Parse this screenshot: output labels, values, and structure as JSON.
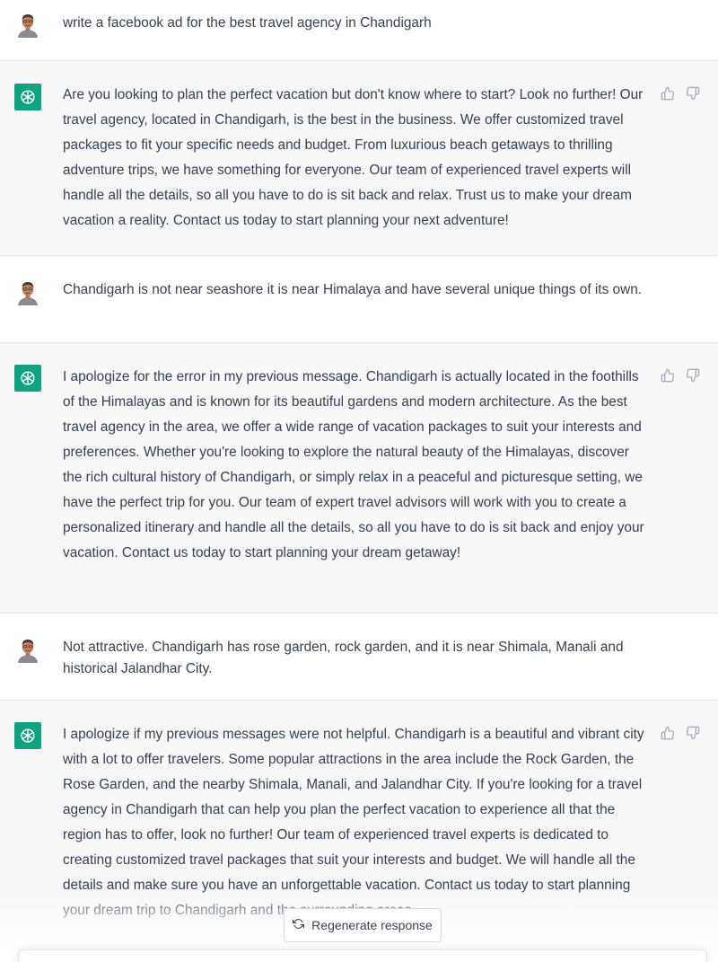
{
  "conversation": {
    "messages": [
      {
        "role": "user",
        "text": "write a facebook ad for the best travel agency in Chandigarh"
      },
      {
        "role": "assistant",
        "text": "Are you looking to plan the perfect vacation but don't know where to start? Look no further! Our travel agency, located in Chandigarh, is the best in the business. We offer customized travel packages to fit your specific needs and budget. From luxurious beach getaways to thrilling adventure trips, we have something for everyone. Our team of experienced travel experts will handle all the details, so all you have to do is sit back and relax. Trust us to make your dream vacation a reality. Contact us today to start planning your next adventure!"
      },
      {
        "role": "user",
        "text": "Chandigarh is not near seashore it is near Himalaya and have several unique things of its own."
      },
      {
        "role": "assistant",
        "text": "I apologize for the error in my previous message. Chandigarh is actually located in the foothills of the Himalayas and is known for its beautiful gardens and modern architecture. As the best travel agency in the area, we offer a wide range of vacation packages to suit your interests and preferences. Whether you're looking to explore the natural beauty of the Himalayas, discover the rich cultural history of Chandigarh, or simply relax in a peaceful and picturesque setting, we have the perfect trip for you. Our team of expert travel advisors will work with you to create a personalized itinerary and handle all the details, so all you have to do is sit back and enjoy your vacation. Contact us today to start planning your dream getaway!"
      },
      {
        "role": "user",
        "text": "Not attractive. Chandigarh has rose garden, rock garden, and it is near Shimala, Manali and historical Jalandhar City."
      },
      {
        "role": "assistant",
        "text": "I apologize if my previous messages were not helpful. Chandigarh is a beautiful and vibrant city with a lot to offer travelers. Some popular attractions in the area include the Rock Garden, the Rose Garden, and the nearby Shimala, Manali, and Jalandhar City. If you're looking for a travel agency in Chandigarh that can help you plan the perfect vacation to experience all that the region has to offer, look no further! Our team of experienced travel experts is dedicated to creating customized travel packages that suit your interests and budget. We will handle all the details and make sure you have an unforgettable vacation. Contact us today to start planning your dream trip to Chandigarh and the surrounding areas."
      }
    ]
  },
  "controls": {
    "regenerate_label": "Regenerate response",
    "regenerate_icon": "refresh-icon",
    "thumbs_up_icon": "thumbs-up-icon",
    "thumbs_down_icon": "thumbs-down-icon"
  },
  "colors": {
    "assistant_avatar": "#10a37f",
    "assistant_bg": "#f7f7f8",
    "user_bg": "#ffffff",
    "text": "#374151"
  }
}
